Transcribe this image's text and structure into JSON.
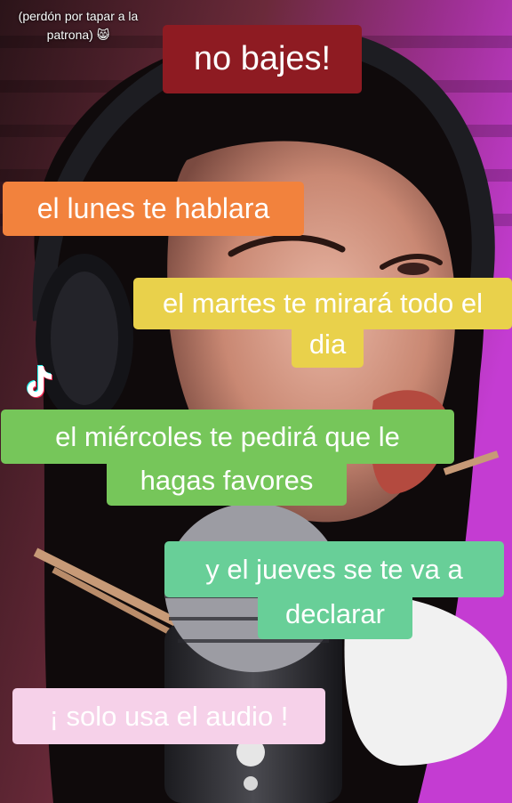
{
  "note": {
    "line1": "(perdón por tapar a la",
    "line2": "patrona)",
    "emoji": "😸"
  },
  "title": "no bajes!",
  "captions": {
    "monday": "el lunes te hablara",
    "tuesday_line1": "el martes te mirará todo el",
    "tuesday_line2": "dia",
    "wednesday_line1": "el miércoles te pedirá que le",
    "wednesday_line2": "hagas favores",
    "thursday_line1": "y el jueves se te va a",
    "thursday_line2": "declarar",
    "audio": "¡ solo usa el audio !"
  },
  "colors": {
    "title_bg": "#8e1b22",
    "monday_bg": "#f2823d",
    "tuesday_bg": "#e9d14b",
    "wednesday_bg": "#76c65a",
    "thursday_bg": "#68cf98",
    "audio_bg": "#f6d1e9"
  },
  "icons": {
    "app_logo": "tiktok-logo-icon"
  }
}
